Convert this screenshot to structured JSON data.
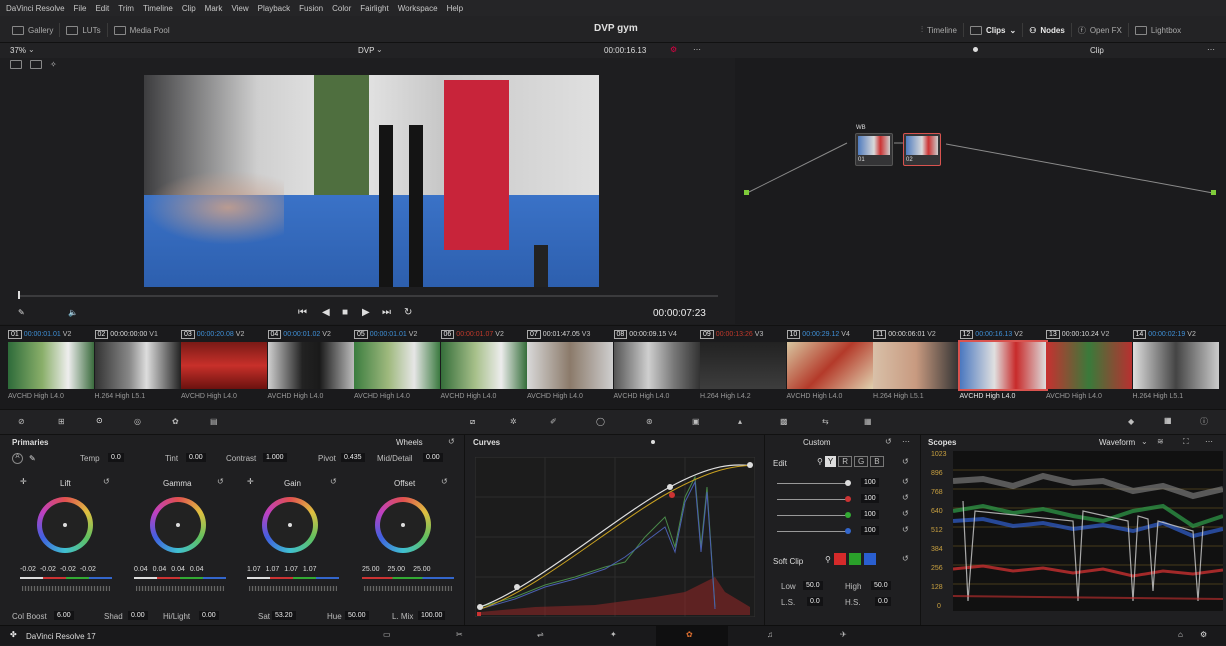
{
  "menu": [
    "DaVinci Resolve",
    "File",
    "Edit",
    "Trim",
    "Timeline",
    "Clip",
    "Mark",
    "View",
    "Playback",
    "Fusion",
    "Color",
    "Fairlight",
    "Workspace",
    "Help"
  ],
  "toolbar": {
    "left": [
      "Gallery",
      "LUTs",
      "Media Pool"
    ],
    "project_title": "DVP gym",
    "right": [
      "Timeline",
      "Clips",
      "Nodes",
      "Open FX",
      "Lightbox"
    ]
  },
  "viewer": {
    "zoom": "37%",
    "clip_name": "DVP",
    "timecode_top": "00:00:16.13",
    "timecode_bottom": "00:00:07:23"
  },
  "nodegraph": {
    "mode": "Clip",
    "node1_label": "WB",
    "node1_num": "01",
    "node2_num": "02"
  },
  "clips": [
    {
      "num": "01",
      "tc": "00:00:01.01",
      "track": "V2",
      "codec": "AVCHD High L4.0",
      "tc_color": "blue",
      "thumb": "linear-gradient(90deg,#2e6b3a,#8aaf6a 40%,#eee 70%,#3a6b3d)"
    },
    {
      "num": "02",
      "tc": "00:00:00:00",
      "track": "V1",
      "codec": "H.264 High L5.1",
      "tc_color": "white",
      "thumb": "linear-gradient(90deg,#333,#888 40%,#ddd 60%,#222)"
    },
    {
      "num": "03",
      "tc": "00:00:20.08",
      "track": "V2",
      "codec": "AVCHD High L4.0",
      "tc_color": "blue",
      "thumb": "linear-gradient(180deg,#7a1a16,#c8302a 50%,#6b120f)"
    },
    {
      "num": "04",
      "tc": "00:00:01.02",
      "track": "V2",
      "codec": "AVCHD High L4.0",
      "tc_color": "blue",
      "thumb": "linear-gradient(90deg,#cfcfcf,#222 40%,#1a1a1a 60%,#bcbcbc)"
    },
    {
      "num": "05",
      "tc": "00:00:01.01",
      "track": "V2",
      "codec": "AVCHD High L4.0",
      "tc_color": "blue",
      "thumb": "linear-gradient(90deg,#3b7d3f,#9fb97e 40%,#e6e6e6 70%,#3b7a40)"
    },
    {
      "num": "06",
      "tc": "00:00:01.07",
      "track": "V2",
      "codec": "AVCHD High L4.0",
      "tc_color": "red",
      "thumb": "linear-gradient(90deg,#356e3a,#a7c08a 40%,#ececec 70%,#356e3a)"
    },
    {
      "num": "07",
      "tc": "00:01:47.05",
      "track": "V3",
      "codec": "AVCHD High L4.0",
      "tc_color": "white",
      "thumb": "linear-gradient(90deg,#d9d9d9,#8b7a6a 50%,#cfcfcf)"
    },
    {
      "num": "08",
      "tc": "00:00:09.15",
      "track": "V4",
      "codec": "AVCHD High L4.0",
      "tc_color": "white",
      "thumb": "linear-gradient(90deg,#555,#cfcfcf 40%,#777 70%,#333)"
    },
    {
      "num": "09",
      "tc": "00:00:13:26",
      "track": "V3",
      "codec": "H.264 High L4.2",
      "tc_color": "red",
      "thumb": "linear-gradient(180deg,#222,#3d3d3d)"
    },
    {
      "num": "10",
      "tc": "00:00:29.12",
      "track": "V4",
      "codec": "AVCHD High L4.0",
      "tc_color": "blue",
      "thumb": "linear-gradient(135deg,#d8c6a0,#b43a2a 50%,#e0d2b0)"
    },
    {
      "num": "11",
      "tc": "00:00:06:01",
      "track": "V2",
      "codec": "H.264 High L5.1",
      "tc_color": "white",
      "thumb": "linear-gradient(90deg,#d8c0a8,#c89a80 50%,#333)"
    },
    {
      "num": "12",
      "tc": "00:00:16.13",
      "track": "V2",
      "codec": "AVCHD High L4.0",
      "tc_color": "blue",
      "thumb": "linear-gradient(90deg,#4b78c0,#e0e0e0 40%,#c82a2a 65%,#ddd)",
      "selected": true
    },
    {
      "num": "13",
      "tc": "00:00:10.24",
      "track": "V2",
      "codec": "AVCHD High L4.0",
      "tc_color": "white",
      "thumb": "linear-gradient(90deg,#c83030,#3a7a3a 50%,#b83030)"
    },
    {
      "num": "14",
      "tc": "00:00:02:19",
      "track": "V2",
      "codec": "H.264 High L5.1",
      "tc_color": "blue",
      "thumb": "linear-gradient(90deg,#ddd,#444 50%,#ccc)"
    }
  ],
  "primaries": {
    "title": "Primaries",
    "mode": "Wheels",
    "top": {
      "temp_label": "Temp",
      "temp": "0.0",
      "tint_label": "Tint",
      "tint": "0.00",
      "contrast_label": "Contrast",
      "contrast": "1.000",
      "pivot_label": "Pivot",
      "pivot": "0.435",
      "middetail_label": "Mid/Detail",
      "middetail": "0.00"
    },
    "wheels": [
      {
        "name": "Lift",
        "values": [
          "-0.02",
          "-0.02",
          "-0.02",
          "-0.02"
        ]
      },
      {
        "name": "Gamma",
        "values": [
          "0.04",
          "0.04",
          "0.04",
          "0.04"
        ]
      },
      {
        "name": "Gain",
        "values": [
          "1.07",
          "1.07",
          "1.07",
          "1.07"
        ]
      },
      {
        "name": "Offset",
        "values": [
          "25.00",
          "25.00",
          "25.00"
        ]
      }
    ],
    "bottom": {
      "colboost_label": "Col Boost",
      "colboost": "6.00",
      "shad_label": "Shad",
      "shad": "0.00",
      "hilight_label": "Hi/Light",
      "hilight": "0.00",
      "sat_label": "Sat",
      "sat": "53.20",
      "hue_label": "Hue",
      "hue": "50.00",
      "lmix_label": "L. Mix",
      "lmix": "100.00"
    }
  },
  "curves": {
    "title": "Curves",
    "mode": "Custom"
  },
  "custom": {
    "edit_label": "Edit",
    "channels": [
      "Y",
      "R",
      "G",
      "B"
    ],
    "intensities": [
      "100",
      "100",
      "100",
      "100"
    ],
    "softclip_label": "Soft Clip",
    "low_label": "Low",
    "low": "50.0",
    "high_label": "High",
    "high": "50.0",
    "ls_label": "L.S.",
    "ls": "0.0",
    "hs_label": "H.S.",
    "hs": "0.0"
  },
  "scopes": {
    "title": "Scopes",
    "mode": "Waveform",
    "ticks": [
      "1023",
      "896",
      "768",
      "640",
      "512",
      "384",
      "256",
      "128",
      "0"
    ]
  },
  "footer": {
    "app": "DaVinci Resolve 17"
  }
}
